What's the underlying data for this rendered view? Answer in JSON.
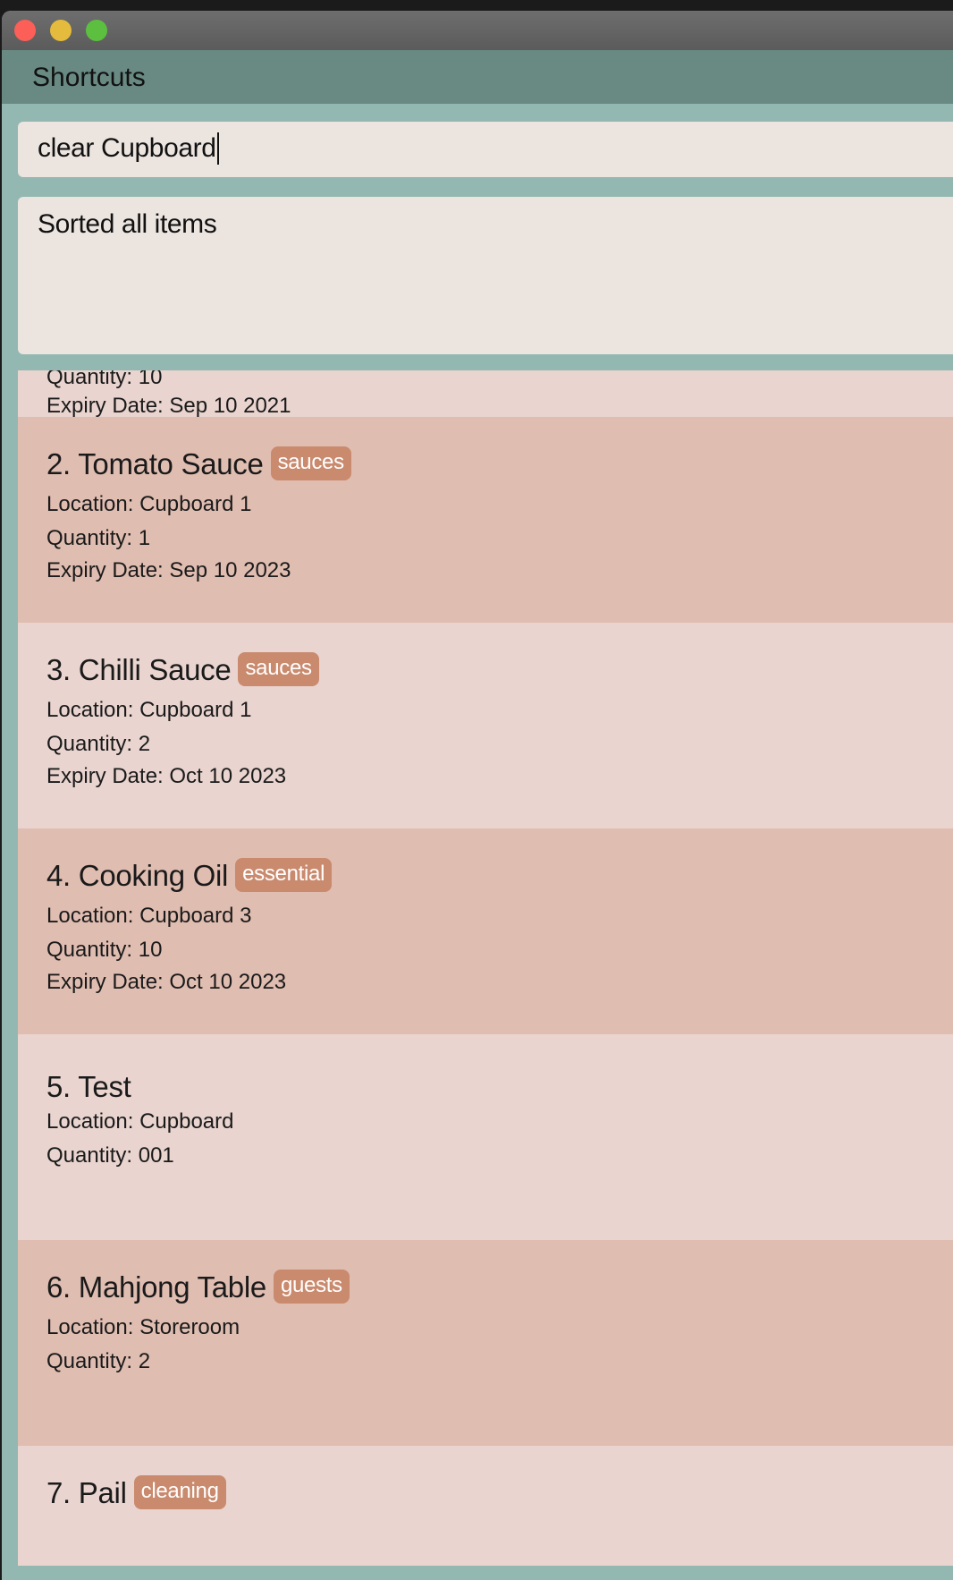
{
  "window": {
    "colors": {
      "close": "#fc5f57",
      "minimize": "#e4bb3d",
      "maximize": "#5dbf40"
    }
  },
  "menu": {
    "items": [
      "Shortcuts"
    ]
  },
  "command_box": {
    "value": "clear Cupboard"
  },
  "result_box": {
    "text": "Sorted all items"
  },
  "items": [
    {
      "title": "",
      "tag": "",
      "location": "",
      "quantity": "Quantity: 10",
      "expiry": "Expiry Date: Sep 10 2021"
    },
    {
      "title": "2. Tomato Sauce",
      "tag": "sauces",
      "location": "Location: Cupboard 1",
      "quantity": "Quantity: 1",
      "expiry": "Expiry Date: Sep 10 2023"
    },
    {
      "title": "3. Chilli Sauce",
      "tag": "sauces",
      "location": "Location: Cupboard 1",
      "quantity": "Quantity: 2",
      "expiry": "Expiry Date: Oct 10 2023"
    },
    {
      "title": "4. Cooking Oil",
      "tag": "essential",
      "location": "Location: Cupboard 3",
      "quantity": "Quantity: 10",
      "expiry": "Expiry Date: Oct 10 2023"
    },
    {
      "title": "5. Test",
      "tag": "",
      "location": "Location: Cupboard",
      "quantity": "Quantity: 001",
      "expiry": ""
    },
    {
      "title": "6. Mahjong Table",
      "tag": "guests",
      "location": "Location: Storeroom",
      "quantity": "Quantity: 2",
      "expiry": ""
    },
    {
      "title": "7. Pail",
      "tag": "cleaning",
      "location": "",
      "quantity": "",
      "expiry": ""
    }
  ],
  "colors": {
    "card_light": "#e9d4cf",
    "card_dark": "#e0bdb1",
    "tag": "#c98a6e",
    "background": "#93b8b1",
    "menubar": "#698a83"
  }
}
